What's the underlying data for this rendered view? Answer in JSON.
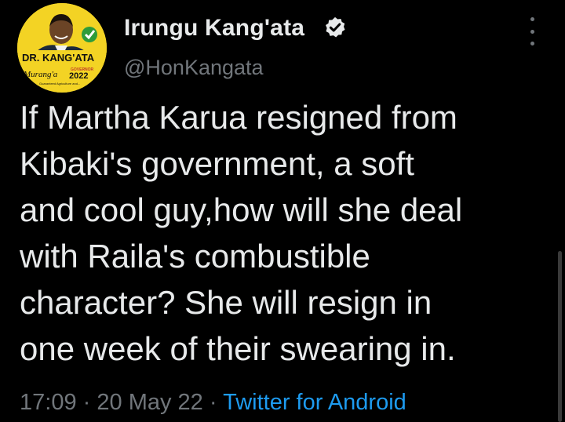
{
  "tweet": {
    "author_name": "Irungu Kang'ata",
    "handle": "@HonKangata",
    "avatar": {
      "banner_text": "DR. KANG'ATA",
      "region_text": "Murang'a",
      "role_text": "GOVERNOR",
      "year_text": "2022",
      "tagline_text": "Guaranteed Agriculture and..."
    },
    "verified_icon": "verified-badge-icon",
    "more_icon": "more-options-icon",
    "text_lines": [
      "If Martha Karua resigned from",
      "Kibaki's government, a soft",
      "and cool guy,how will she deal",
      "with Raila's combustible",
      "character? She will resign in",
      "one week of their swearing in."
    ],
    "time": "17:09",
    "separator": "·",
    "date": "20 May 22",
    "source": "Twitter for Android"
  },
  "colors": {
    "background": "#000000",
    "text_primary": "#e7e9ea",
    "text_secondary": "#71767b",
    "link": "#1d9bf0",
    "avatar_bg": "#f3d324"
  }
}
